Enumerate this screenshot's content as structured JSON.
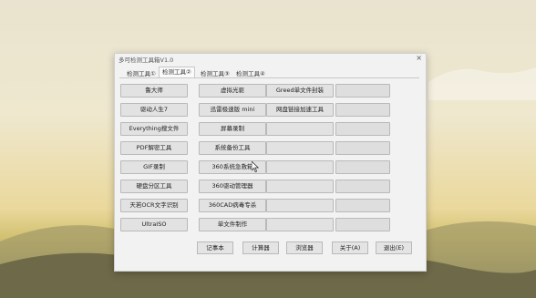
{
  "window": {
    "title": "多可检测工具箱V1.0",
    "close_label": "×"
  },
  "tabs": [
    {
      "label": "检测工具①",
      "active": false
    },
    {
      "label": "检测工具②",
      "active": true
    },
    {
      "label": "检测工具③",
      "active": false
    },
    {
      "label": "检测工具④",
      "active": false
    }
  ],
  "tools": {
    "col1": [
      "鲁大师",
      "驱动人生7",
      "Everything搜文件",
      "PDF解密工具",
      "GIF录制",
      "硬盘分区工具",
      "天若OCR文字识别",
      "UltraISO"
    ],
    "col2": [
      "虚拟光驱",
      "迅雷极速版 mini",
      "屏幕录制",
      "系统备份工具",
      "360系统急救箱",
      "360驱动管理器",
      "360CAD病毒专杀",
      "单文件制作"
    ],
    "col3": [
      "Greed单文件封装",
      "网盘链接加速工具",
      "",
      "",
      "",
      "",
      "",
      ""
    ],
    "col4": [
      "",
      "",
      "",
      "",
      "",
      "",
      "",
      ""
    ]
  },
  "bottom_buttons": [
    "记事本",
    "计算器",
    "浏览器",
    "关于(A)",
    "退出(E)"
  ],
  "icons": {
    "close": "close-icon",
    "pointer": "mouse-pointer-icon"
  }
}
